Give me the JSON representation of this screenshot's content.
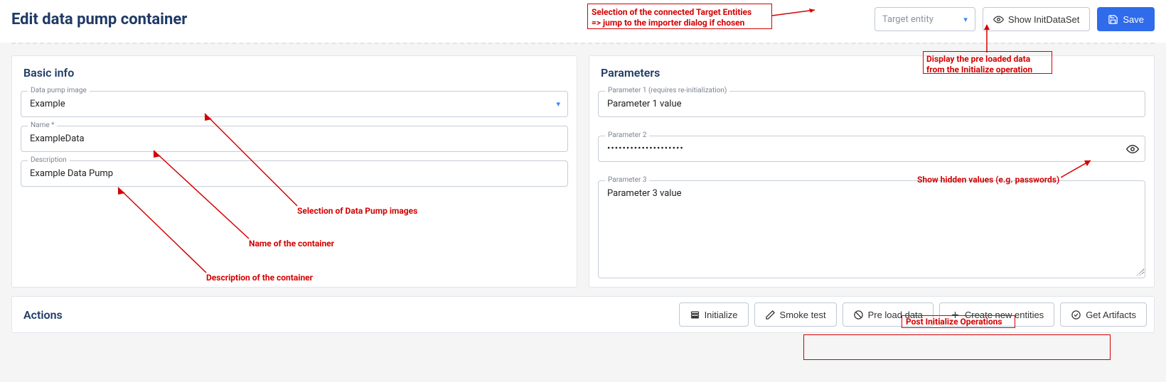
{
  "header": {
    "title": "Edit data pump container",
    "target_entity_placeholder": "Target entity",
    "show_init_label": "Show InitDataSet",
    "save_label": "Save"
  },
  "basic_info": {
    "panel_title": "Basic info",
    "image_label": "Data pump image",
    "image_value": "Example",
    "name_label": "Name *",
    "name_value": "ExampleData",
    "desc_label": "Description",
    "desc_value": "Example Data Pump"
  },
  "parameters": {
    "panel_title": "Parameters",
    "p1_label": "Parameter 1 (requires re-initialization)",
    "p1_value": "Parameter 1 value",
    "p2_label": "Parameter 2",
    "p2_value": "••••••••••••••••••••",
    "p3_label": "Parameter 3",
    "p3_value": "Parameter 3 value"
  },
  "actions": {
    "panel_title": "Actions",
    "initialize": "Initialize",
    "smoke_test": "Smoke test",
    "pre_load": "Pre load data",
    "create_new": "Create new entities",
    "get_artifacts": "Get Artifacts"
  },
  "annotations": {
    "target_sel": "Selection of the connected Target Entities\n=> jump to the importer dialog if chosen",
    "show_init": "Display the pre loaded data\nfrom the Initialize operation",
    "img_sel": "Selection of Data Pump images",
    "name": "Name of the container",
    "desc": "Description of the container",
    "show_hidden": "Show hidden values (e.g. passwords)",
    "post_init": "Post Initialize Operations"
  }
}
